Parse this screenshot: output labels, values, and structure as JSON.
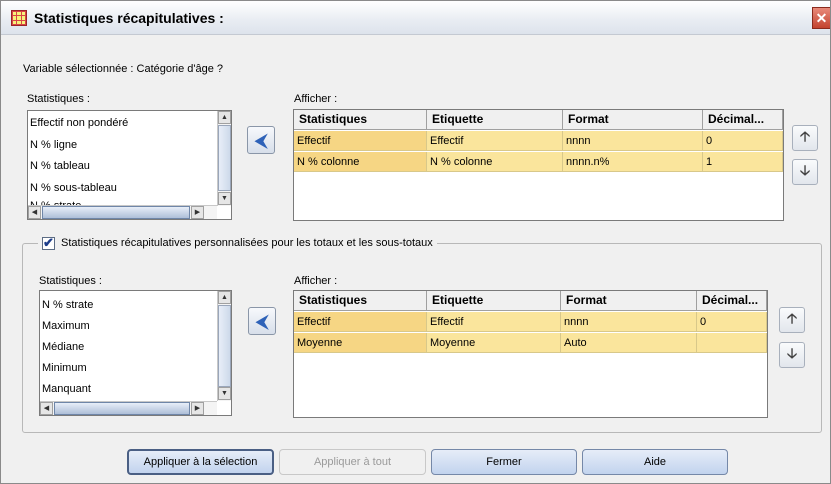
{
  "window": {
    "title": "Statistiques récapitulatives :",
    "close_label": "✕"
  },
  "variable_text": "Variable sélectionnée : Catégorie d'âge ?",
  "top_section": {
    "statistics_label": "Statistiques :",
    "display_label": "Afficher :",
    "list_items": [
      "Effectif non pondéré",
      "N % ligne",
      "N % tableau",
      "N % sous-tableau",
      "N % strate"
    ],
    "table": {
      "headers": [
        "Statistiques",
        "Etiquette",
        "Format",
        "Décimal..."
      ],
      "rows": [
        [
          "Effectif",
          "Effectif",
          "nnnn",
          "0"
        ],
        [
          "N % colonne",
          "N % colonne",
          "nnnn.n%",
          "1"
        ]
      ]
    }
  },
  "custom_totals": {
    "checked": true,
    "label": "Statistiques récapitulatives personnalisées pour les totaux et les sous-totaux"
  },
  "bottom_section": {
    "statistics_label": "Statistiques :",
    "display_label": "Afficher :",
    "list_items": [
      "N % strate",
      "Maximum",
      "Médiane",
      "Minimum",
      "Manquant"
    ],
    "table": {
      "headers": [
        "Statistiques",
        "Etiquette",
        "Format",
        "Décimal..."
      ],
      "rows": [
        [
          "Effectif",
          "Effectif",
          "nnnn",
          "0"
        ],
        [
          "Moyenne",
          "Moyenne",
          "Auto",
          ""
        ]
      ]
    }
  },
  "icons": {
    "move": "left-arrow-icon",
    "up": "up-arrow-icon",
    "down": "down-arrow-icon"
  },
  "buttons": {
    "apply_selection": "Appliquer à la sélection",
    "apply_all": "Appliquer à tout",
    "close": "Fermer",
    "help": "Aide"
  },
  "colors": {
    "cell_highlight": "#fae59c",
    "accent": "#2e62b8"
  }
}
